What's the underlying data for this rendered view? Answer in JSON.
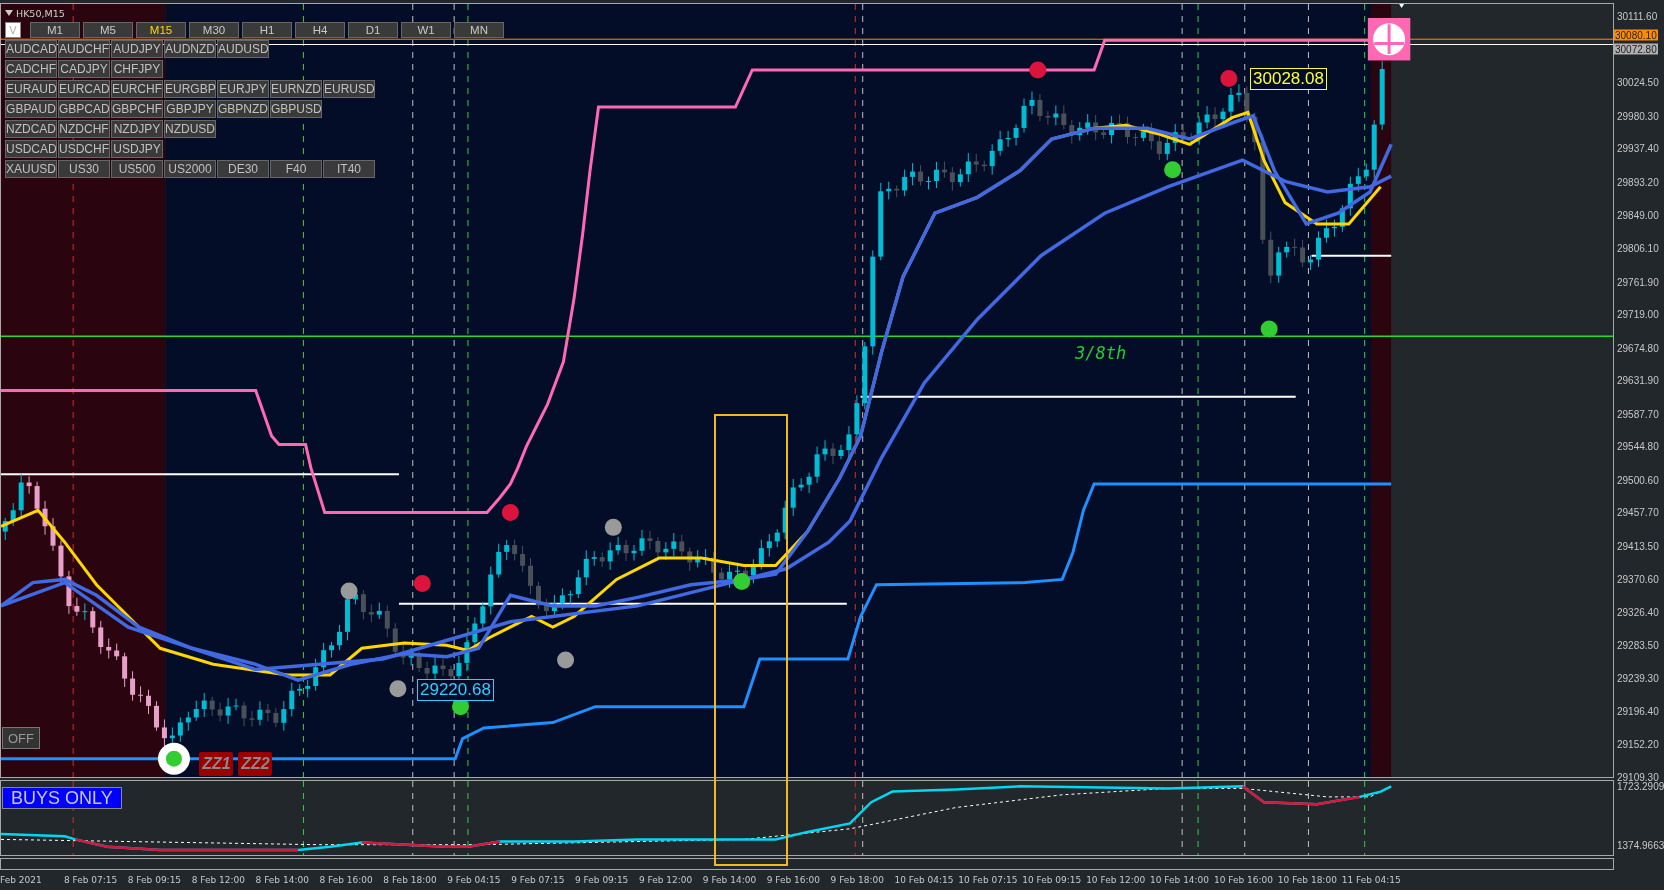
{
  "chart": {
    "title": "HK50,M15"
  },
  "toggle_button": "V",
  "timeframes": [
    {
      "label": "M1",
      "selected": false
    },
    {
      "label": "M5",
      "selected": false
    },
    {
      "label": "M15",
      "selected": true
    },
    {
      "label": "M30",
      "selected": false
    },
    {
      "label": "H1",
      "selected": false
    },
    {
      "label": "H4",
      "selected": false
    },
    {
      "label": "D1",
      "selected": false
    },
    {
      "label": "W1",
      "selected": false
    },
    {
      "label": "MN",
      "selected": false
    }
  ],
  "symbol_rows": [
    [
      "AUDCAD",
      "AUDCHF",
      "AUDJPY",
      "AUDNZD",
      "AUDUSD"
    ],
    [
      "CADCHF",
      "CADJPY",
      "CHFJPY"
    ],
    [
      "EURAUD",
      "EURCAD",
      "EURCHF",
      "EURGBP",
      "EURJPY",
      "EURNZD",
      "EURUSD"
    ],
    [
      "GBPAUD",
      "GBPCAD",
      "GBPCHF",
      "GBPJPY",
      "GBPNZD",
      "GBPUSD"
    ],
    [
      "NZDCAD",
      "NZDCHF",
      "NZDJPY",
      "NZDUSD"
    ],
    [
      "USDCAD",
      "USDCHF",
      "USDJPY"
    ],
    [
      "XAUUSD",
      "US30",
      "US500",
      "US2000",
      "DE30",
      "F40",
      "IT40"
    ]
  ],
  "off_button": "OFF",
  "zigzag_tags": [
    "ZZ1",
    "ZZ2"
  ],
  "chart_labels": {
    "fibo_level": "3/8th",
    "high_price": "30028.08",
    "low_price": "29220.68"
  },
  "price_axis": {
    "ticks": [
      "30111.60",
      "30024.50",
      "29980.30",
      "29937.40",
      "29893.20",
      "29849.00",
      "29806.10",
      "29761.90",
      "29719.00",
      "29674.80",
      "29631.90",
      "29587.70",
      "29544.80",
      "29500.60",
      "29457.70",
      "29413.50",
      "29370.60",
      "29326.40",
      "29283.50",
      "29239.30",
      "29196.40",
      "29152.20",
      "29109.30"
    ],
    "line_tag": "30080.10",
    "bid_tag": "30072.80"
  },
  "indicator": {
    "signal": "BUYS ONLY",
    "axis_ticks": [
      "1723.2909",
      "1374.9663"
    ]
  },
  "time_axis": [
    "Feb 2021",
    "8 Feb 07:15",
    "8 Feb 09:15",
    "8 Feb 12:00",
    "8 Feb 14:00",
    "8 Feb 16:00",
    "8 Feb 18:00",
    "9 Feb 04:15",
    "9 Feb 07:15",
    "9 Feb 09:15",
    "9 Feb 12:00",
    "9 Feb 14:00",
    "9 Feb 16:00",
    "9 Feb 18:00",
    "10 Feb 04:15",
    "10 Feb 07:15",
    "10 Feb 09:15",
    "10 Feb 12:00",
    "10 Feb 14:00",
    "10 Feb 16:00",
    "10 Feb 18:00",
    "11 Feb 04:15"
  ]
}
